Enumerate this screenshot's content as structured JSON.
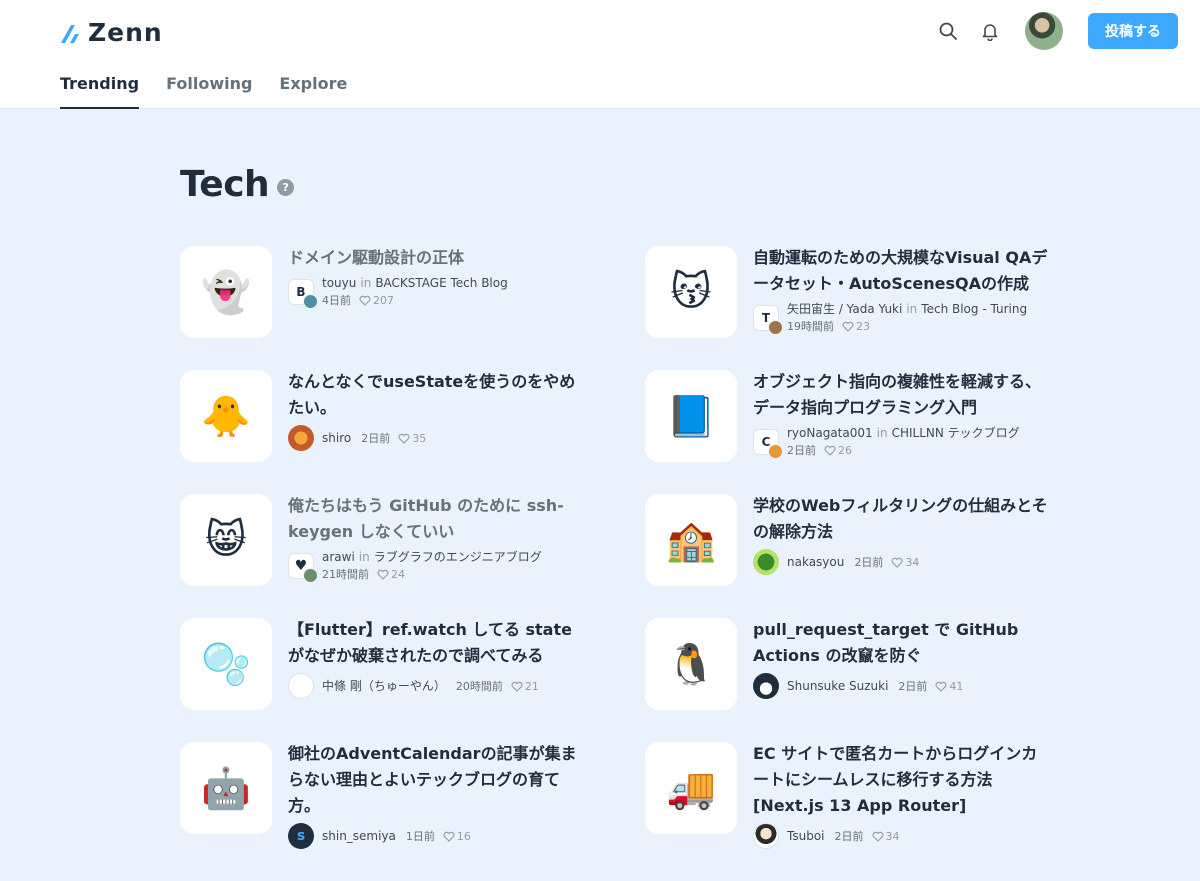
{
  "brand": {
    "name": "Zenn"
  },
  "header": {
    "post_label": "投稿する"
  },
  "tabs": [
    {
      "label": "Trending"
    },
    {
      "label": "Following"
    },
    {
      "label": "Explore"
    }
  ],
  "page": {
    "title": "Tech",
    "help": "?"
  },
  "articles": [
    {
      "emoji": "👻",
      "title": "ドメイン駆動設計の正体",
      "author": "touyu",
      "in": "in",
      "publication": "BACKSTAGE Tech Blog",
      "time": "4日前",
      "likes": "207"
    },
    {
      "emoji": "😽",
      "title": "自動運転のための大規模なVisual QAデータセット・AutoScenesQAの作成",
      "author": "矢田宙生 / Yada Yuki",
      "in": "in",
      "publication": "Tech Blog - Turing",
      "time": "19時間前",
      "likes": "23"
    },
    {
      "emoji": "🐥",
      "title": "なんとなくでuseStateを使うのをやめたい。",
      "author": "shiro",
      "time": "2日前",
      "likes": "35"
    },
    {
      "emoji": "📘",
      "title": "オブジェクト指向の複雑性を軽減する、データ指向プログラミング入門",
      "author": "ryoNagata001",
      "in": "in",
      "publication": "CHILLNN テックブログ",
      "time": "2日前",
      "likes": "26"
    },
    {
      "emoji": "😸",
      "title": "俺たちはもう GitHub のために ssh-keygen しなくていい",
      "author": "arawi",
      "in": "in",
      "publication": "ラブグラフのエンジニアブログ",
      "time": "21時間前",
      "likes": "24"
    },
    {
      "emoji": "🏫",
      "title": "学校のWebフィルタリングの仕組みとその解除方法",
      "author": "nakasyou",
      "time": "2日前",
      "likes": "34"
    },
    {
      "emoji": "🫧",
      "title": "【Flutter】ref.watch してる state がなぜか破棄されたので調べてみる",
      "author": "中條 剛（ちゅーやん）",
      "time": "20時間前",
      "likes": "21"
    },
    {
      "emoji": "🐧",
      "title": "pull_request_target で GitHub Actions の改竄を防ぐ",
      "author": "Shunsuke Suzuki",
      "time": "2日前",
      "likes": "41"
    },
    {
      "emoji": "🤖",
      "title": "御社のAdventCalendarの記事が集まらない理由とよいテックブログの育て方。",
      "author": "shin_semiya",
      "time": "1日前",
      "likes": "16"
    },
    {
      "emoji": "🚚",
      "title": "EC サイトで匿名カートからログインカートにシームレスに移行する方法 [Next.js 13 App Router]",
      "author": "Tsuboi",
      "time": "2日前",
      "likes": "34"
    }
  ],
  "colors": {
    "accent": "#3ea8ff",
    "background": "#eaf3fd",
    "text": "#1f2d3d"
  },
  "avatar_initials": {
    "pub_b": "B",
    "pub_t": "T",
    "pub_c": "C",
    "shin": "s"
  }
}
